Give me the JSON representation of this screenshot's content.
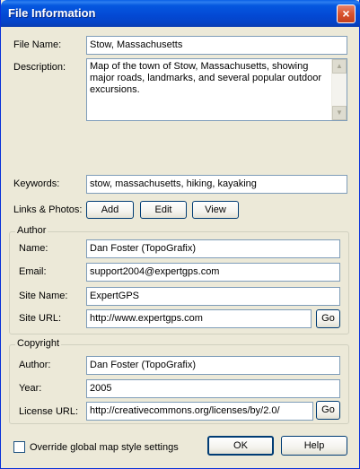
{
  "window": {
    "title": "File Information",
    "close_glyph": "×"
  },
  "labels": {
    "file_name": "File Name:",
    "description": "Description:",
    "keywords": "Keywords:",
    "links_photos": "Links & Photos:"
  },
  "fields": {
    "file_name": "Stow, Massachusetts",
    "description": "Map of the town of Stow, Massachusetts, showing major roads, landmarks, and several popular outdoor excursions.",
    "keywords": "stow, massachusetts, hiking, kayaking"
  },
  "links_buttons": {
    "add": "Add",
    "edit": "Edit",
    "view": "View"
  },
  "author_group": {
    "title": "Author",
    "name_label": "Name:",
    "name": "Dan Foster (TopoGrafix)",
    "email_label": "Email:",
    "email": "support2004@expertgps.com",
    "site_name_label": "Site Name:",
    "site_name": "ExpertGPS",
    "site_url_label": "Site URL:",
    "site_url": "http://www.expertgps.com",
    "go": "Go"
  },
  "copyright_group": {
    "title": "Copyright",
    "author_label": "Author:",
    "author": "Dan Foster (TopoGrafix)",
    "year_label": "Year:",
    "year": "2005",
    "license_label": "License URL:",
    "license_url": "http://creativecommons.org/licenses/by/2.0/",
    "go": "Go"
  },
  "footer": {
    "override_label": "Override global map style settings",
    "override_checked": false,
    "ok": "OK",
    "help": "Help"
  },
  "icons": {
    "scroll_up": "▲",
    "scroll_down": "▼"
  }
}
